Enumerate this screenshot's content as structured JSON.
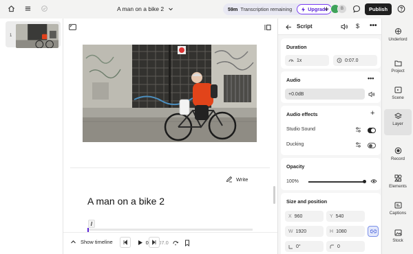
{
  "topbar": {
    "project_title": "A man on a bike 2",
    "transcription_minutes": "59m",
    "transcription_label": "Transcription remaining",
    "upgrade_label": "Upgrade",
    "avatar_initial": "B",
    "publish_label": "Publish"
  },
  "scenes": {
    "items": [
      {
        "number": "1"
      }
    ]
  },
  "main": {
    "write_label": "Write",
    "script_title": "A man on a bike 2",
    "slash_command": "/"
  },
  "playback": {
    "show_timeline_label": "Show timeline",
    "current_time": "0:00.0",
    "separator": "/",
    "total_time": "0:07.0"
  },
  "properties": {
    "header_label": "Script",
    "duration": {
      "title": "Duration",
      "speed": "1x",
      "length": "0:07.0"
    },
    "audio": {
      "title": "Audio",
      "gain": "+0.0dB"
    },
    "audio_effects": {
      "title": "Audio effects",
      "studio_sound_label": "Studio Sound",
      "studio_sound_on": true,
      "ducking_label": "Ducking",
      "ducking_on": false
    },
    "opacity": {
      "title": "Opacity",
      "value": "100%",
      "level": 1.0
    },
    "size_position": {
      "title": "Size and position",
      "x_key": "X",
      "x": "960",
      "y_key": "Y",
      "y": "540",
      "w_key": "W",
      "w": "1920",
      "h_key": "H",
      "h": "1080",
      "rotation": "0°",
      "corner": "0"
    }
  },
  "rail": {
    "items": [
      {
        "label": "Underlord",
        "icon": "underlord-icon"
      },
      {
        "label": "Project",
        "icon": "folder-icon"
      },
      {
        "label": "Scene",
        "icon": "scene-icon"
      },
      {
        "label": "Layer",
        "icon": "layers-icon"
      },
      {
        "label": "Record",
        "icon": "record-icon"
      },
      {
        "label": "Elements",
        "icon": "elements-icon"
      },
      {
        "label": "Captions",
        "icon": "captions-icon"
      },
      {
        "label": "Stock",
        "icon": "stock-icon"
      }
    ],
    "active": "Layer"
  },
  "colors": {
    "accent": "#5b22d6",
    "publish_bg": "#1f1f1f",
    "avatar_green": "#3fa35a",
    "avatar_grey": "#d9d9d9"
  }
}
